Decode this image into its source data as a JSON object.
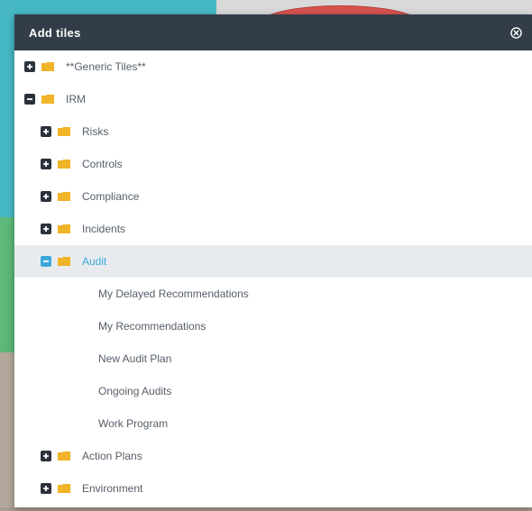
{
  "modal": {
    "title": "Add tiles",
    "close_icon": "close-circle-icon"
  },
  "tree": {
    "generic": {
      "label": "**Generic Tiles**",
      "expanded": false
    },
    "irm": {
      "label": "IRM",
      "expanded": true,
      "children": {
        "risks": {
          "label": "Risks",
          "expanded": false
        },
        "controls": {
          "label": "Controls",
          "expanded": false
        },
        "compliance": {
          "label": "Compliance",
          "expanded": false
        },
        "incidents": {
          "label": "Incidents",
          "expanded": false
        },
        "audit": {
          "label": "Audit",
          "expanded": true,
          "selected": true,
          "items": [
            "My Delayed Recommendations",
            "My Recommendations",
            "New Audit Plan",
            "Ongoing Audits",
            "Work Program"
          ]
        },
        "action_plans": {
          "label": "Action Plans",
          "expanded": false
        },
        "environment": {
          "label": "Environment",
          "expanded": false
        }
      }
    }
  },
  "colors": {
    "header_bg": "#333d4a",
    "folder": "#f0b429",
    "selected_text": "#3aa8d8",
    "selected_bg": "#e8ebee",
    "toggle_dark": "#2b323b",
    "toggle_selected": "#3aa8d8"
  }
}
